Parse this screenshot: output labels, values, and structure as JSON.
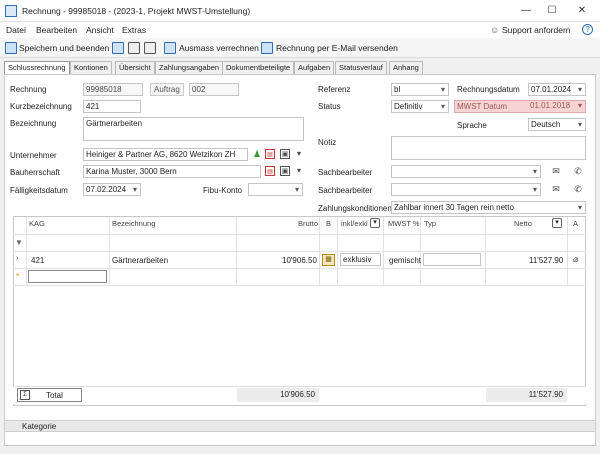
{
  "window": {
    "title": "Rechnung - 99985018 - (2023-1, Projekt MWST-Umstellung)",
    "minimize": "—",
    "maximize": "☐",
    "close": "✕"
  },
  "menu": {
    "items": [
      "Datei",
      "Bearbeiten",
      "Ansicht",
      "Extras"
    ],
    "support": "Support anfordern",
    "help": "?"
  },
  "toolbar": {
    "save_close": "Speichern und beenden",
    "ausmass": "Ausmass verrechnen",
    "email": "Rechnung per E-Mail versenden"
  },
  "tabs": [
    "Schlussrechnung",
    "Kontionen",
    "Übersicht",
    "Zahlungsangaben",
    "Dokumentbeteiligte",
    "Aufgaben",
    "Statusverlauf",
    "Anhang"
  ],
  "form": {
    "rechnung_label": "Rechnung",
    "rechnung_value": "99985018",
    "auftrag_label": "Auftrag",
    "auftrag_value": "002",
    "kurzbez_label": "Kurzbezeichnung",
    "kurzbez_value": "421",
    "bezeichnung_label": "Bezeichnung",
    "bezeichnung_value": "Gärtnerarbeiten",
    "unternehmer_label": "Unternehmer",
    "unternehmer_value": "Heiniger & Partner AG, 8620 Wetzikon ZH",
    "bauherr_label": "Bauherrschaft",
    "bauherr_value": "Karina Muster, 3000 Bern",
    "faellig_label": "Fälligkeitsdatum",
    "faellig_value": "07.02.2024",
    "fibu_label": "Fibu-Konto",
    "fibu_value": "",
    "referenz_label": "Referenz",
    "referenz_value": "bl",
    "status_label": "Status",
    "status_value": "Definitiv",
    "rechnungsdatum_label": "Rechnungsdatum",
    "rechnungsdatum_value": "07.01.2024",
    "mwst_label": "MWST Datum",
    "mwst_value": "01.01.2018",
    "sprache_label": "Sprache",
    "sprache_value": "Deutsch",
    "notiz_label": "Notiz",
    "sachbearbeiter1_label": "Sachbearbeiter",
    "sachbearbeiter2_label": "Sachbearbeiter",
    "zahlung_label": "Zahlungskonditionen",
    "zahlung_value": "Zahlbar innert 30 Tagen rein netto"
  },
  "grid": {
    "headers": {
      "kag": "KAG",
      "bezeichnung": "Bezeichnung",
      "brutto": "Brutto",
      "b": "B",
      "inkl": "inkl/exkl",
      "mwst": "MWST %",
      "typ": "Typ",
      "netto": "Netto",
      "a": "A"
    },
    "row": {
      "kag": "421",
      "bezeichnung": "Gärtnerarbeiten",
      "brutto": "10'906.50",
      "inkl": "exklusiv",
      "mwst": "gemischt",
      "netto": "11'527.90"
    },
    "total_label": "Total",
    "total_brutto": "10'906.50",
    "total_netto": "11'527.90"
  },
  "kategorie": "Kategorie"
}
